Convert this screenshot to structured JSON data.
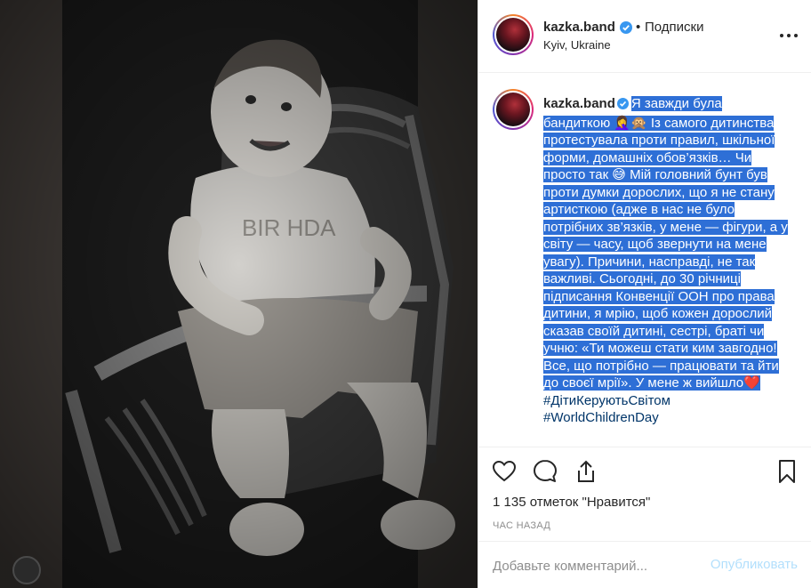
{
  "post": {
    "username": "kazka.band",
    "follow_dot": "•",
    "follow_label": "Подписки",
    "location": "Kyiv, Ukraine"
  },
  "caption": {
    "username": "kazka.band",
    "selected_text": "Я завжди була бандиткою 🤦‍♀️🙊 Із самого дитинства протестувала проти правил, шкільної форми, домашніх обов’язків… Чи просто так 😅 Мій головний бунт був проти думки дорослих, що я не стану артисткою (адже в нас не було потрібних зв’язків, у мене — фігури, а у світу — часу, щоб звернути на мене увагу). Причини, насправді, не так важливі. Сьогодні, до 30 річниці підписання Конвенції ООН про права дитини, я мрію, щоб кожен дорослий сказав своїй дитині, сестрі, браті чи учню: «Ти можеш стати ким завгодно! Все, що потрібно — працювати та йти до своєї мрії». У мене ж вийшло❤️",
    "hashtag_1": "#ДітиКеруютьСвітом",
    "hashtag_2": "#WorldChildrenDay"
  },
  "stats": {
    "likes": "1 135 отметок \"Нравится\"",
    "time": "ЧАС НАЗАД"
  },
  "comment_box": {
    "placeholder": "Добавьте комментарий...",
    "publish_label": "Опубликовать"
  },
  "icons": {
    "like": "heart-icon",
    "comment": "comment-icon",
    "share": "share-icon",
    "save": "bookmark-icon",
    "more": "more-options-icon",
    "verified": "verified-badge-icon"
  },
  "colors": {
    "selection": "#2e6fd6",
    "verified": "#3897f0",
    "hashtag": "#003569",
    "publish_disabled": "#b2dffc"
  }
}
